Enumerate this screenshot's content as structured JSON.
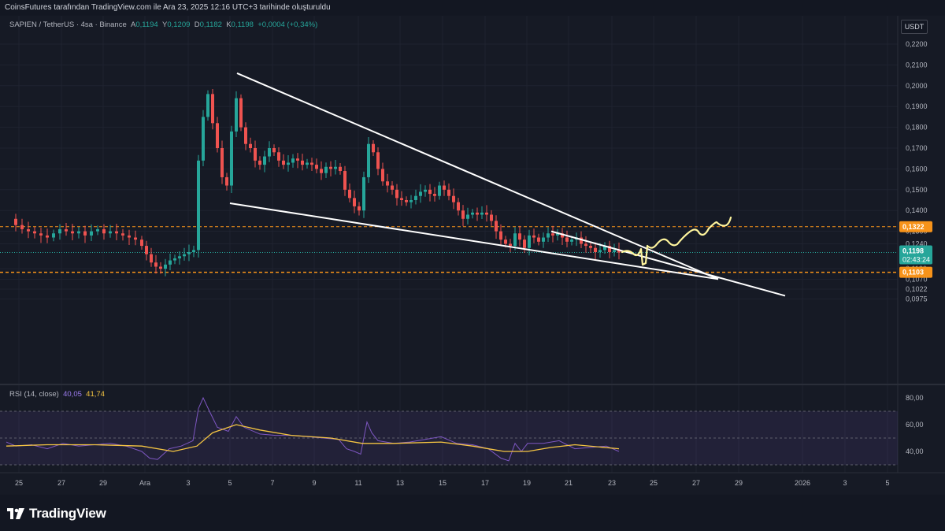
{
  "header": {
    "attribution": "CoinsFutures tarafından TradingView.com ile Ara 23, 2025 12:16 UTC+3 tarihinde oluşturuldu"
  },
  "legend": {
    "symbol": "SAPIEN / TetherUS · 4sa · Binance",
    "open_label": "A",
    "open": "0,1194",
    "high_label": "Y",
    "high": "0,1209",
    "low_label": "D",
    "low": "0,1182",
    "close_label": "K",
    "close": "0,1198",
    "change": "+0,0004 (+0,34%)"
  },
  "currency_button": "USDT",
  "price_axis": {
    "ticks": [
      "0,2200",
      "0,2100",
      "0,2000",
      "0,1900",
      "0,1800",
      "0,1700",
      "0,1600",
      "0,1500",
      "0,1400",
      "0,1300",
      "0,1240",
      "0,1120",
      "0,1070",
      "0,1022",
      "0,0975"
    ],
    "level_high": "0,1322",
    "level_low": "0,1103",
    "last_price": "0,1198",
    "countdown": "02:43:24"
  },
  "rsi": {
    "label": "RSI (14, close)",
    "value_rsi": "40,05",
    "value_ma": "41,74",
    "ticks": [
      "80,00",
      "60,00",
      "40,00"
    ]
  },
  "time_axis": {
    "ticks": [
      "25",
      "27",
      "29",
      "Ara",
      "3",
      "5",
      "7",
      "9",
      "11",
      "13",
      "15",
      "17",
      "19",
      "21",
      "23",
      "25",
      "27",
      "29",
      "2026",
      "3",
      "5"
    ]
  },
  "colors": {
    "up": "#26a69a",
    "down": "#ef5350",
    "level": "#f7931a",
    "trendline": "#ffffff",
    "drawing": "#fff59d",
    "rsi": "#7e57c2",
    "rsi_ma": "#f5c542",
    "background": "#161a25"
  },
  "footer": {
    "brand": "TradingView"
  }
}
